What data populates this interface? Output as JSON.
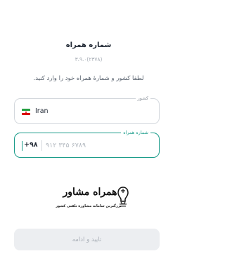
{
  "header": {
    "title": "شماره همراه",
    "version": "۳.۹.۰(۲۳۷۸)"
  },
  "instructions": "لطفا کشور و شمارهٔ همراه خود را وارد کنید.",
  "country_field": {
    "label": "کشور",
    "value": "Iran",
    "flag_icon": "iran-flag-icon"
  },
  "phone_field": {
    "label": "شماره همراه",
    "prefix": "+۹۸",
    "placeholder": "۹۱۲ ۳۴۵ ۶۷۸۹",
    "value": ""
  },
  "logo": {
    "name": "همراه مشاور",
    "tagline": "بزرگترین سامانه مشاوره تلفنی کشور",
    "icon": "logo-icon"
  },
  "submit": {
    "label": "تایید و ادامه"
  },
  "colors": {
    "accent": "#1a9c8a",
    "disabled_button_bg": "#eceef1",
    "disabled_button_text": "#a9afb7"
  }
}
